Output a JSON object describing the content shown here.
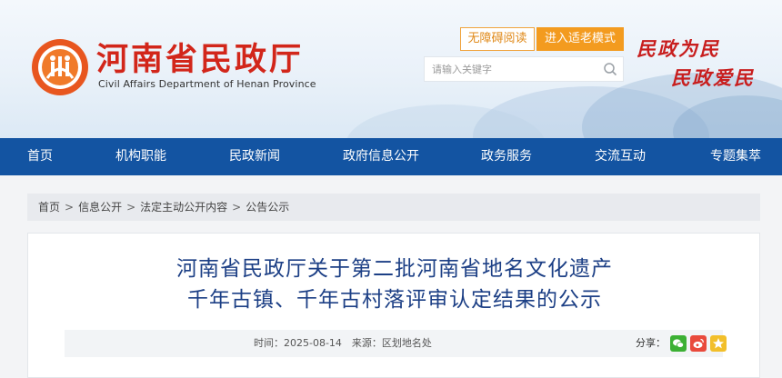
{
  "header": {
    "site_title": "河南省民政厅",
    "site_subtitle": "Civil Affairs Department of Henan Province",
    "accessibility_button": "无障碍阅读",
    "elder_mode_button": "进入适老模式",
    "search_placeholder": "请输入关键字",
    "slogan_line1": "民政为民",
    "slogan_line2": "民政爱民"
  },
  "nav": {
    "items": [
      {
        "label": "首页"
      },
      {
        "label": "机构职能"
      },
      {
        "label": "民政新闻"
      },
      {
        "label": "政府信息公开"
      },
      {
        "label": "政务服务"
      },
      {
        "label": "交流互动"
      },
      {
        "label": "专题集萃"
      }
    ]
  },
  "breadcrumb": {
    "items": [
      "首页",
      "信息公开",
      "法定主动公开内容",
      "公告公示"
    ],
    "separator": ">"
  },
  "article": {
    "title_line1": "河南省民政厅关于第二批河南省地名文化遗产",
    "title_line2": "千年古镇、千年古村落评审认定结果的公示",
    "meta": "时间：2025-08-14　来源：区划地名处",
    "share_label": "分享：",
    "share_icons": [
      "wechat-icon",
      "weibo-icon",
      "qzone-icon"
    ]
  },
  "colors": {
    "brand_red": "#d2261a",
    "nav_blue": "#1354a2",
    "accent_orange": "#f39b1f",
    "title_blue": "#1c3f85"
  }
}
